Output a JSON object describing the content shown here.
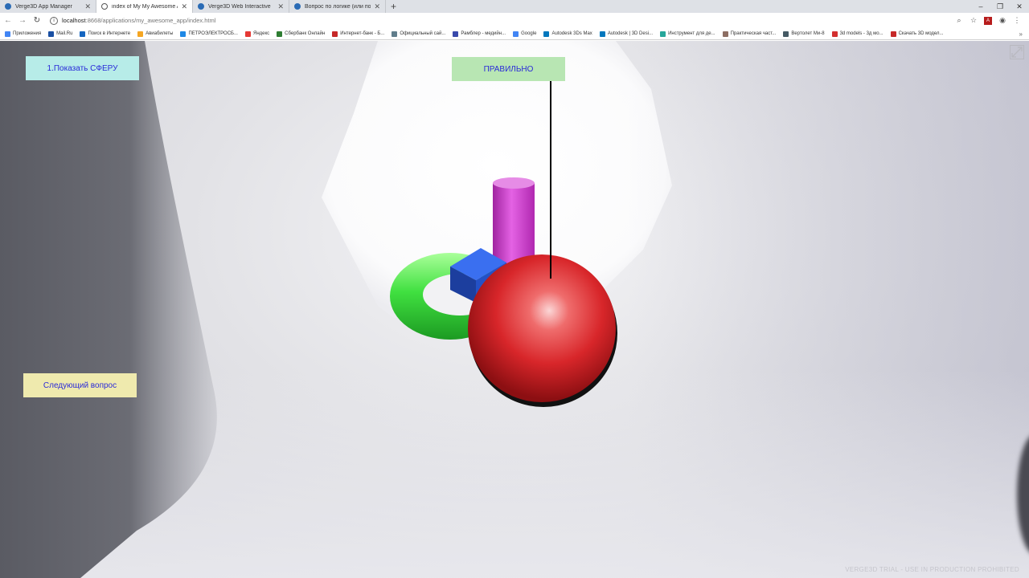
{
  "browser": {
    "tabs": [
      {
        "title": "Verge3D App Manager",
        "active": false
      },
      {
        "title": "index of My My Awesome App",
        "active": true
      },
      {
        "title": "Verge3D Web Interactive",
        "active": false
      },
      {
        "title": "Вопрос по логике (или по связи",
        "active": false
      }
    ],
    "new_tab": "+",
    "window_controls": [
      "–",
      "❐",
      "✕"
    ],
    "url_host": "localhost",
    "url_path": ":8668/applications/my_awesome_app/index.html"
  },
  "bookmarks": [
    {
      "label": "Приложения",
      "color": "#4285f4"
    },
    {
      "label": "Mail.Ru",
      "color": "#1a4fa3"
    },
    {
      "label": "Поиск в Интернете",
      "color": "#1565c0"
    },
    {
      "label": "Авиабилеты",
      "color": "#f5a623"
    },
    {
      "label": "ПЕТРОЭЛЕКТРОСБ...",
      "color": "#1e88e5"
    },
    {
      "label": "Яндекс",
      "color": "#e53935"
    },
    {
      "label": "Сбербанк Онлайн",
      "color": "#2e7d32"
    },
    {
      "label": "Интернет-банк - Б...",
      "color": "#c62828"
    },
    {
      "label": "Официальный сай...",
      "color": "#607d8b"
    },
    {
      "label": "Рамблер - медийн...",
      "color": "#3949ab"
    },
    {
      "label": "Google",
      "color": "#4285f4"
    },
    {
      "label": "Autodesk 3Ds Max",
      "color": "#0277bd"
    },
    {
      "label": "Autodesk | 3D Desi...",
      "color": "#0277bd"
    },
    {
      "label": "Инструмент для де...",
      "color": "#26a69a"
    },
    {
      "label": "Практическая част...",
      "color": "#8d6e63"
    },
    {
      "label": "Вертолет Ми-8",
      "color": "#455a64"
    },
    {
      "label": "3d models - 3д мо...",
      "color": "#d32f2f"
    },
    {
      "label": "Скачать 3D модел...",
      "color": "#c62828"
    }
  ],
  "bookmarks_more": "»",
  "app": {
    "show_sphere_button": "1.Показать СФЕРУ",
    "next_question_button": "Следующий вопрос",
    "result_label": "ПРАВИЛЬНО",
    "watermark": "VERGE3D TRIAL - USE IN PRODUCTION PROHIBITED"
  },
  "colors": {
    "sphere": "#d8262a",
    "torus": "#33d43a",
    "cylinder": "#d63ad6",
    "cube": "#2a5bd0",
    "button_text": "#2a2ad8"
  }
}
